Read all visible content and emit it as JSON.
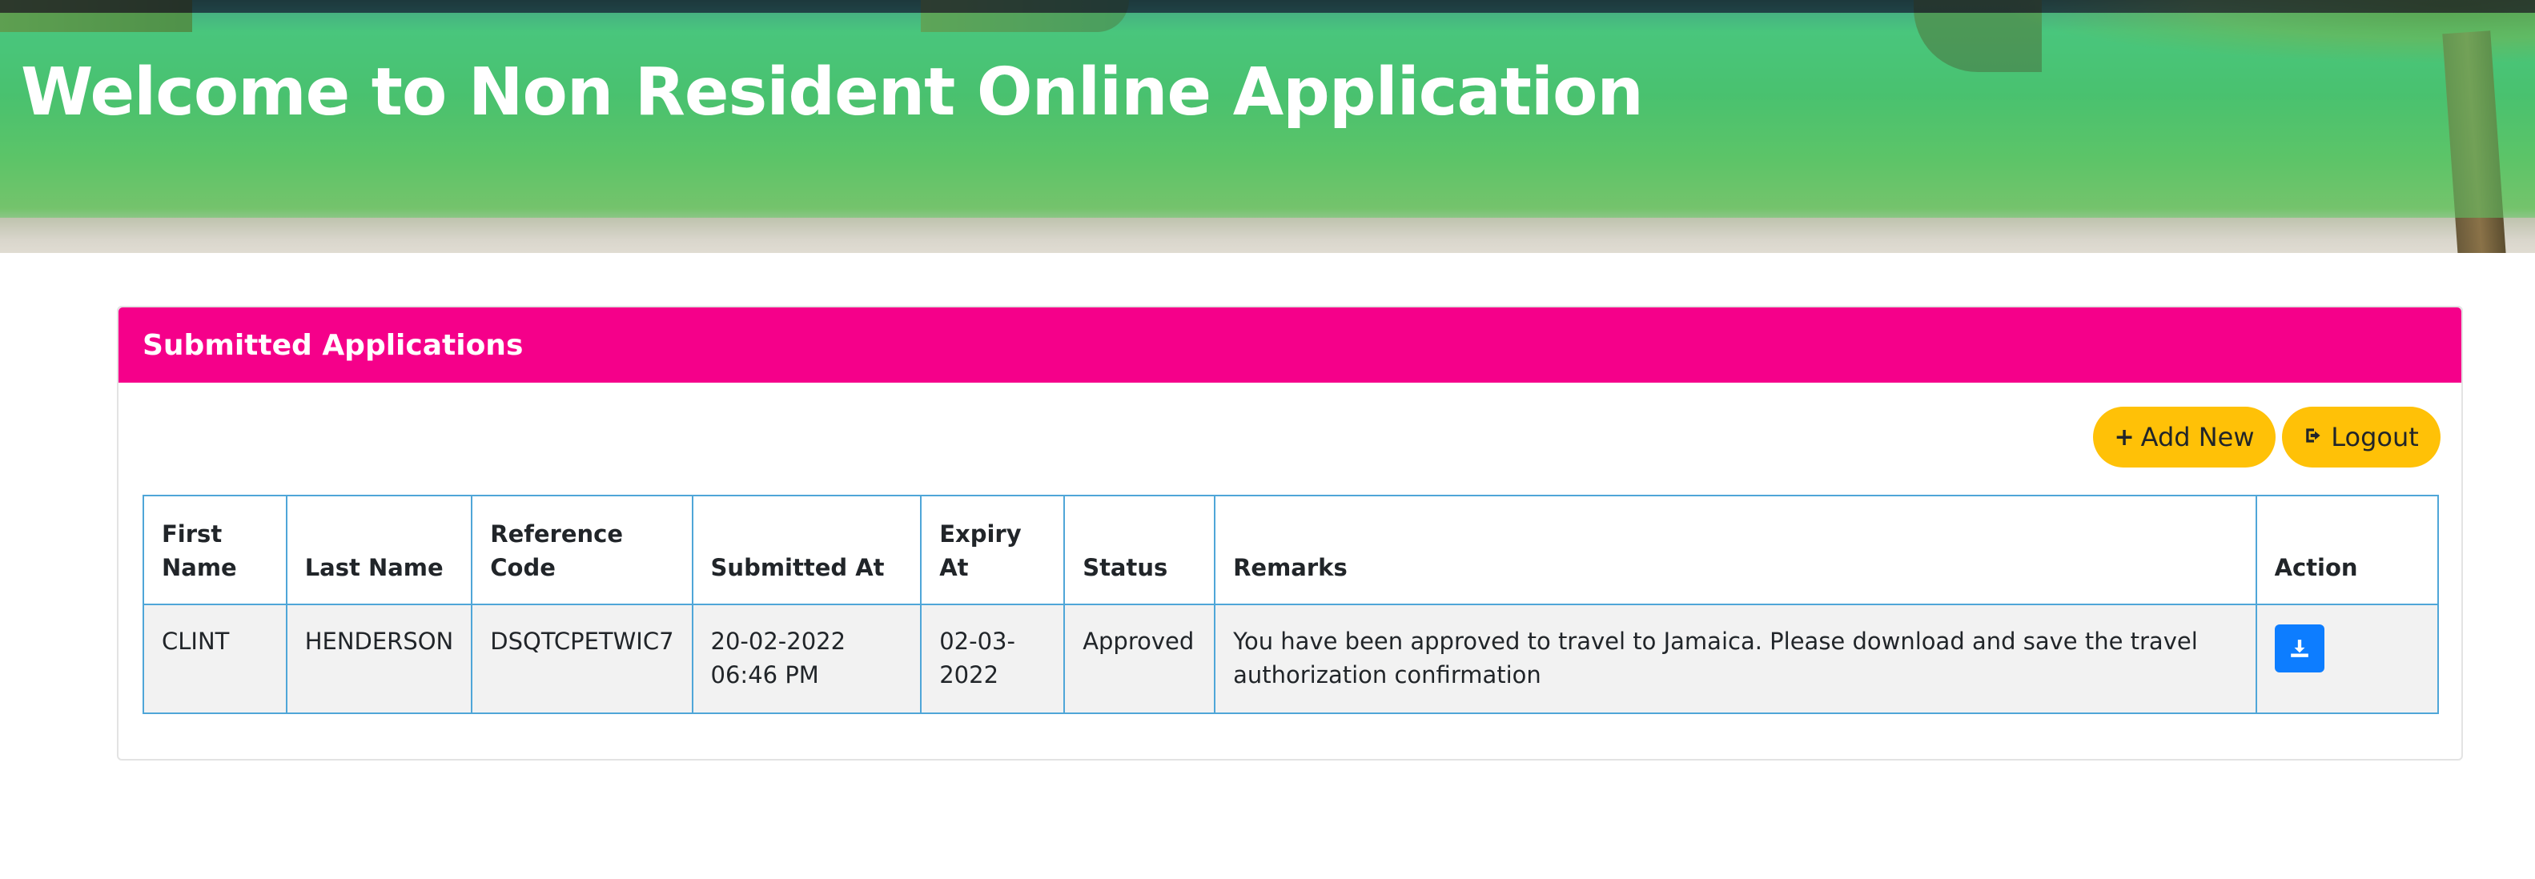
{
  "hero": {
    "title": "Welcome to Non Resident Online Application"
  },
  "panel": {
    "title": "Submitted Applications",
    "add_new_label": "Add New",
    "logout_label": "Logout"
  },
  "table": {
    "headers": [
      "First Name",
      "Last Name",
      "Reference Code",
      "Submitted At",
      "Expiry At",
      "Status",
      "Remarks",
      "Action"
    ],
    "rows": [
      {
        "first_name": "CLINT",
        "last_name": "HENDERSON",
        "reference_code": "DSQTCPETWIC7",
        "submitted_at": "20-02-2022 06:46 PM",
        "expiry_at": "02-03-2022",
        "status": "Approved",
        "remarks": "You have been approved to travel to Jamaica. Please download and save the travel authorization confirmation",
        "action_icon": "download-icon"
      }
    ]
  },
  "colors": {
    "panel_header": "#f5008a",
    "button": "#ffc107",
    "download_button": "#0d7dff",
    "table_border": "#4fa6d8"
  }
}
